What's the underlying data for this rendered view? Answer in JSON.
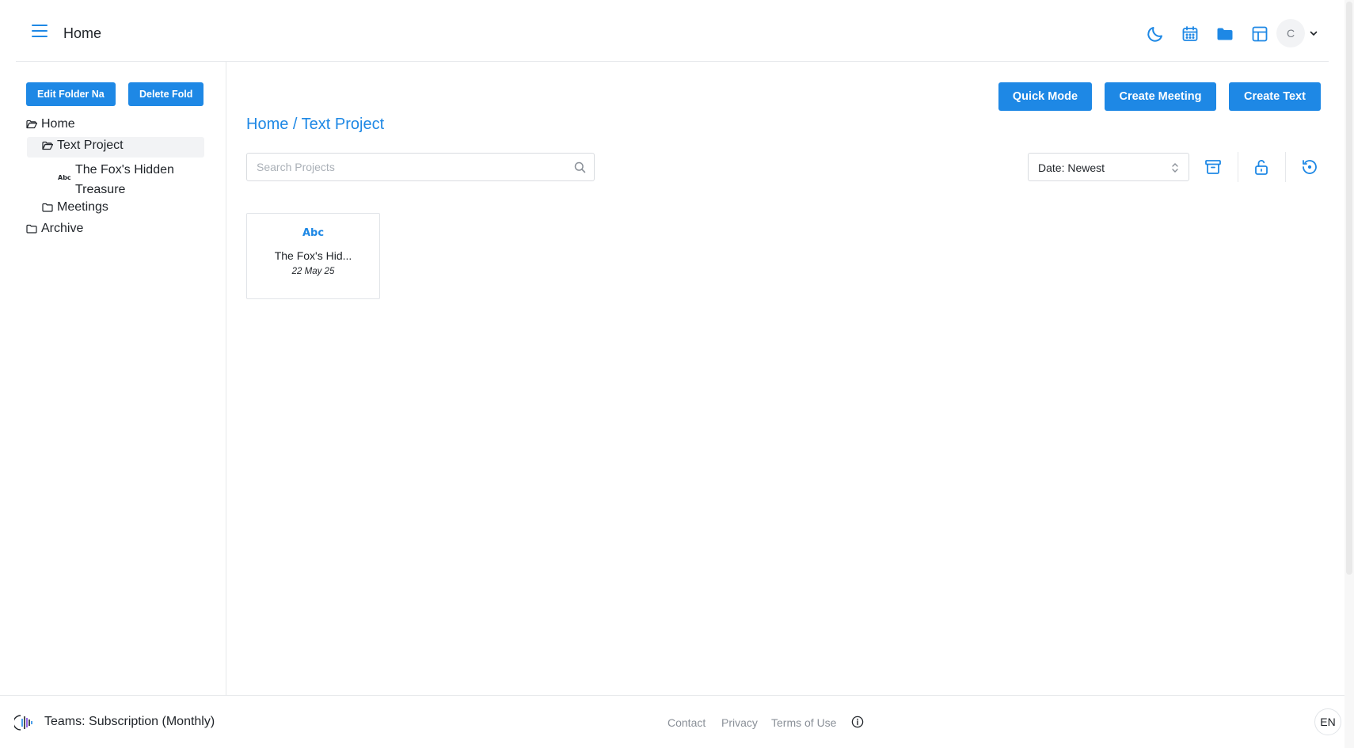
{
  "header": {
    "title": "Home",
    "avatar_initial": "C"
  },
  "sidebar": {
    "edit_folder_label": "Edit Folder Na",
    "delete_folder_label": "Delete Fold",
    "tree": {
      "home": "Home",
      "text_project": "Text Project",
      "doc_abc_icon": "Abc",
      "doc_line1": "The Fox's Hidden",
      "doc_line2": "Treasure",
      "meetings": "Meetings",
      "archive": "Archive"
    }
  },
  "main": {
    "actions": {
      "quick_mode": "Quick Mode",
      "create_meeting": "Create Meeting",
      "create_text": "Create Text"
    },
    "breadcrumb": {
      "root": "Home",
      "separator": " / ",
      "current": "Text Project"
    },
    "search": {
      "placeholder": "Search Projects",
      "value": ""
    },
    "sort": {
      "selected": "Date: Newest"
    },
    "projects": [
      {
        "icon_text": "Abc",
        "name": "The Fox's Hid...",
        "date": "22 May 25"
      }
    ]
  },
  "footer": {
    "plan": "Teams: Subscription (Monthly)",
    "links": {
      "contact": "Contact",
      "privacy": "Privacy",
      "terms": "Terms of Use"
    },
    "language": "EN"
  },
  "colors": {
    "accent": "#1e88e5",
    "border": "#e6e8eb",
    "muted_text": "#8a9098",
    "selected_bg": "#f2f3f5"
  },
  "icons": {
    "header": [
      "menu-icon",
      "moon-icon",
      "calendar-icon",
      "folder-icon",
      "layout-grid-icon",
      "chevron-down-icon"
    ],
    "tools": [
      "archive-box-icon",
      "unlock-icon",
      "history-icon"
    ],
    "tree": [
      "folder-open-icon",
      "folder-icon",
      "abc-icon"
    ],
    "footer": [
      "plan-logo-icon",
      "info-icon"
    ]
  }
}
